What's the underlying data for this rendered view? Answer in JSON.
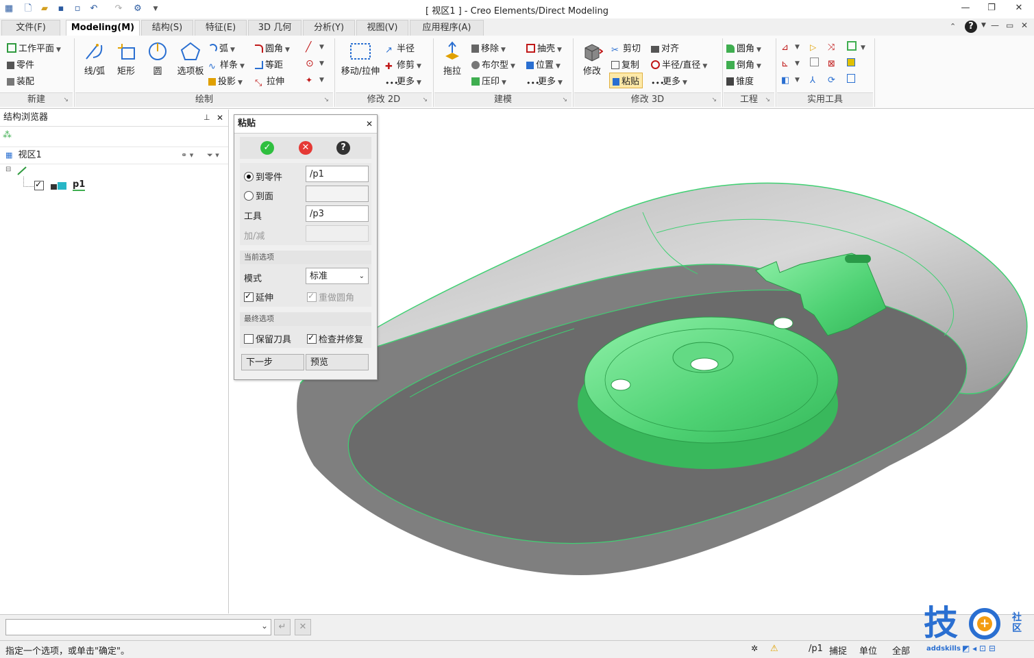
{
  "window": {
    "title": "[ 视区1 ] - Creo Elements/Direct Modeling"
  },
  "tabs": [
    {
      "label": "文件(F)"
    },
    {
      "label": "Modeling(M)"
    },
    {
      "label": "结构(S)"
    },
    {
      "label": "特征(E)"
    },
    {
      "label": "3D 几何"
    },
    {
      "label": "分析(Y)"
    },
    {
      "label": "视图(V)"
    },
    {
      "label": "应用程序(A)"
    }
  ],
  "ribbon": {
    "groups": {
      "new": "新建",
      "draw": "绘制",
      "modify2d": "修改 2D",
      "model": "建模",
      "modify3d": "修改 3D",
      "engineering": "工程",
      "utilities": "实用工具"
    },
    "new": {
      "workplane": "工作平面",
      "part": "零件",
      "assembly": "装配"
    },
    "draw": {
      "line_arc": "线/弧",
      "rect": "矩形",
      "circle": "圆",
      "palette": "选项板",
      "arc": "弧",
      "spline": "样条",
      "project": "投影",
      "fillet": "圆角",
      "offset": "等距",
      "stretch": "拉伸"
    },
    "modify2d": {
      "move_stretch": "移动/拉伸",
      "radius": "半径",
      "trim": "修剪",
      "more": "更多"
    },
    "model": {
      "pull": "拖拉",
      "move": "移除",
      "boolean": "布尔型",
      "imprint": "压印",
      "shell": "抽壳",
      "position": "位置",
      "more": "更多"
    },
    "modify3d": {
      "modify": "修改",
      "cut": "剪切",
      "copy": "复制",
      "paste": "粘贴",
      "align": "对齐",
      "radius_diameter": "半径/直径",
      "more": "更多"
    },
    "engineering": {
      "fillet": "圆角",
      "chamfer": "倒角",
      "taper": "锥度"
    }
  },
  "browser": {
    "title": "结构浏览器",
    "view_item": "视区1",
    "part_item": "p1"
  },
  "dialog": {
    "title": "粘贴",
    "to_part_label": "到零件",
    "to_part_value": "/p1",
    "to_face_label": "到面",
    "tool_label": "工具",
    "tool_value": "/p3",
    "add_sub_label": "加/减",
    "current_options": "当前选项",
    "mode_label": "模式",
    "mode_value": "标准",
    "extend_label": "延伸",
    "redo_fillet_label": "重做圆角",
    "final_options": "最终选项",
    "keep_tool_label": "保留刀具",
    "check_repair_label": "检查并修复",
    "next_button": "下一步",
    "preview_button": "预览"
  },
  "status": {
    "prompt": "指定一个选项，或单击\"确定\"。",
    "part": "/p1",
    "snap": "捕捉",
    "units": "单位",
    "all": "全部"
  },
  "watermark": {
    "char": "技",
    "side": "社区",
    "url": "addskills"
  },
  "colors": {
    "accent_green": "#55d680",
    "body_gray": "#8c8c8c",
    "blue": "#2a6fd1"
  }
}
